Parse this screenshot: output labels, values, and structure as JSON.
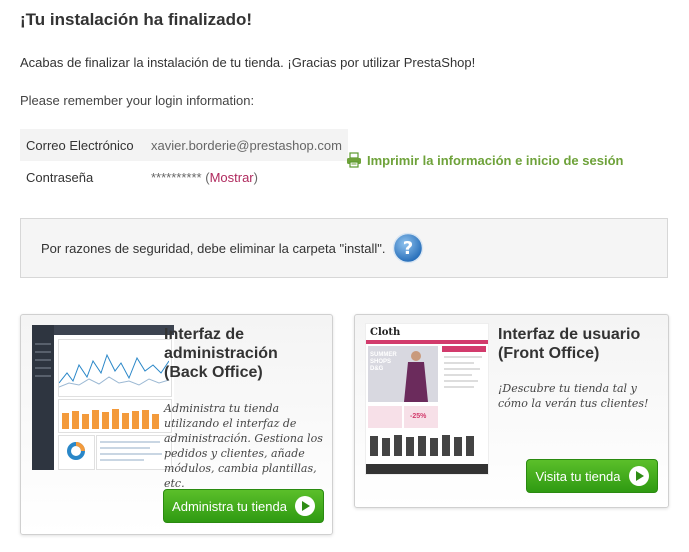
{
  "page": {
    "title": "¡Tu instalación ha finalizado!",
    "intro": "Acabas de finalizar la instalación de tu tienda. ¡Gracias por utilizar PrestaShop!",
    "remember": "Please remember your login information:"
  },
  "credentials": {
    "email_label": "Correo Electrónico",
    "email_value": "xavier.borderie@prestashop.com",
    "password_label": "Contraseña",
    "password_value": "**********",
    "show_open": "(",
    "show_link": "Mostrar",
    "show_close": ")"
  },
  "print": {
    "label": "Imprimir la información e inicio de sesión",
    "icon": "printer-icon",
    "color": "#6ea23a"
  },
  "security": {
    "text": "Por razones de seguridad, debe eliminar la carpeta \"install\".",
    "icon": "help-icon"
  },
  "back_office": {
    "title": "Interfaz de\nadministración\n(Back Office)",
    "description": "Administra tu tienda utilizando el interfaz de administración. Gestiona los pedidos y clientes, añade módulos, cambia plantillas, etc.",
    "button": "Administra tu tienda"
  },
  "front_office": {
    "title": "Interfaz de usuario\n(Front Office)",
    "description": "¡Descubre tu tienda tal y cómo la verán tus clientes!",
    "button": "Visita tu tienda",
    "thumb_brand": "Cloth",
    "thumb_banner": "SUMMER SHOPS D&G",
    "thumb_sale": "-25%"
  },
  "colors": {
    "button_green": "#3aa818",
    "link_pink": "#b02a5e"
  }
}
